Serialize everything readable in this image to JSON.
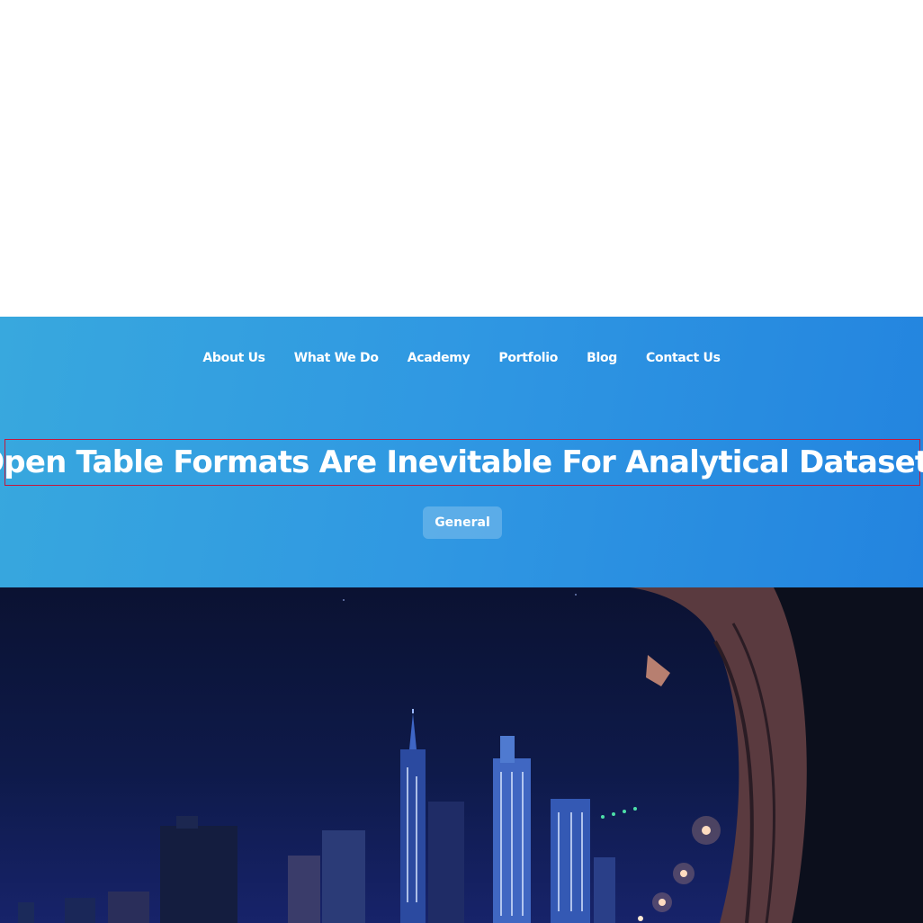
{
  "nav": {
    "items": [
      {
        "label": "About Us"
      },
      {
        "label": "What We Do"
      },
      {
        "label": "Academy"
      },
      {
        "label": "Portfolio"
      },
      {
        "label": "Blog"
      },
      {
        "label": "Contact Us"
      }
    ]
  },
  "hero": {
    "title": "Open Table Formats Are Inevitable For Analytical Datasets",
    "category_tag": "General"
  },
  "colors": {
    "hero_gradient_start": "#38a8de",
    "hero_gradient_end": "#2384df",
    "title_outline": "#c4173d",
    "text": "#ffffff"
  },
  "image": {
    "subject": "city-skyline-at-night"
  }
}
